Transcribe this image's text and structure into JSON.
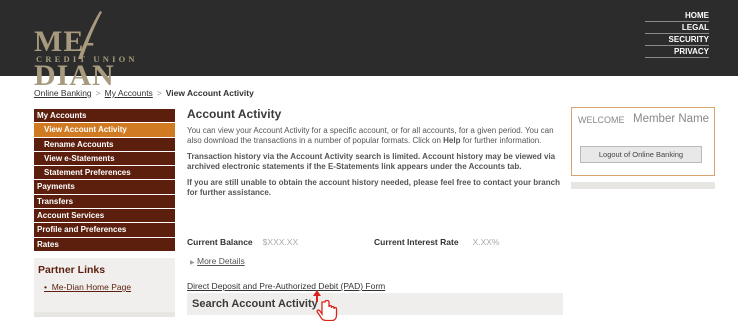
{
  "header": {
    "logo_main": "ME-DIAN",
    "logo_sub": "CREDIT UNION",
    "nav": [
      "HOME",
      "LEGAL",
      "SECURITY",
      "PRIVACY"
    ]
  },
  "breadcrumb": {
    "items": [
      "Online Banking",
      "My Accounts"
    ],
    "current": "View Account Activity"
  },
  "sidebar": {
    "items": [
      {
        "label": "My Accounts",
        "type": "section"
      },
      {
        "label": "View Account Activity",
        "type": "sub",
        "active": true
      },
      {
        "label": "Rename Accounts",
        "type": "sub"
      },
      {
        "label": "View e-Statements",
        "type": "sub"
      },
      {
        "label": "Statement Preferences",
        "type": "sub"
      },
      {
        "label": "Payments",
        "type": "section"
      },
      {
        "label": "Transfers",
        "type": "section"
      },
      {
        "label": "Account Services",
        "type": "section"
      },
      {
        "label": "Profile and Preferences",
        "type": "section"
      },
      {
        "label": "Rates",
        "type": "section"
      }
    ],
    "partner_title": "Partner Links",
    "partner_link": "Me-Dian Home Page"
  },
  "main": {
    "title": "Account Activity",
    "intro_a": "You can view your Account Activity for a specific account, or for all accounts, for a given period. You can also download the transactions in a number of popular formats. Click on ",
    "intro_help": "Help",
    "intro_b": " for further information.",
    "notice1": "Transaction history via the Account Activity search is limited. Account history may be viewed via archived electronic statements if the E-Statements link appears under the Accounts tab.",
    "notice2": "If you are still unable to obtain the account history needed, please feel free to contact your branch for further assistance.",
    "current_balance_label": "Current Balance",
    "current_balance_value": "$XXX.XX",
    "interest_rate_label": "Current Interest Rate",
    "interest_rate_value": "X.XX%",
    "more_details": "More Details",
    "pad_link": "Direct Deposit and Pre-Authorized Debit (PAD) Form",
    "search_title": "Search Account Activity"
  },
  "welcome": {
    "label": "WELCOME",
    "name": "Member Name",
    "logout": "Logout of Online Banking"
  },
  "colors": {
    "nav_bg": "#5c1f0e",
    "nav_active": "#d07a21",
    "header_bg": "#2c2c2c",
    "accent_border": "#d8a36e",
    "cursor_red": "#d9261c"
  },
  "icons": {
    "cursor": "hand-pointer-icon",
    "more_details": "triangle-right-icon"
  }
}
